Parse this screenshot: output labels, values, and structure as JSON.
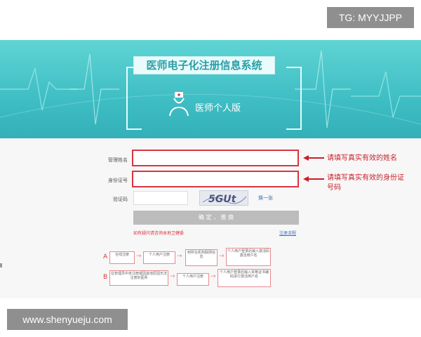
{
  "watermarks": {
    "tg": "TG: MYYJJPP",
    "site": "www.shenyueju.com"
  },
  "header": {
    "system_title": "医师电子化注册信息系统",
    "subtitle": "医师个人版"
  },
  "form": {
    "name_label": "管理姓名",
    "id_label": "身份证号",
    "captcha_label": "验证码",
    "captcha_text": "5GUt",
    "change_link": "换一张",
    "confirm_label": "确 定 ， 推 换",
    "left_note": "如有疑问请咨询本地卫健委",
    "right_link": "注册流程"
  },
  "annotations": {
    "name_hint": "请填写真实有效的姓名",
    "id_hint_line1": "请填写真实有效的身份证",
    "id_hint_line2": "号码"
  },
  "flow": {
    "row_a": {
      "letter": "A",
      "steps": [
        "在线注册",
        "个人用户注册",
        "到所在机构联网信息",
        "个人用户登录后输入激活码激活用户名"
      ]
    },
    "row_b": {
      "letter": "B",
      "steps": [
        "在管理员中未注册或因其他原因无法注册的医师",
        "个人用户注册",
        "个人用户登录后输入资格证书编码进行激活用户名"
      ]
    }
  },
  "colors": {
    "accent_red": "#d9363e",
    "banner_teal": "#3fbec4"
  }
}
